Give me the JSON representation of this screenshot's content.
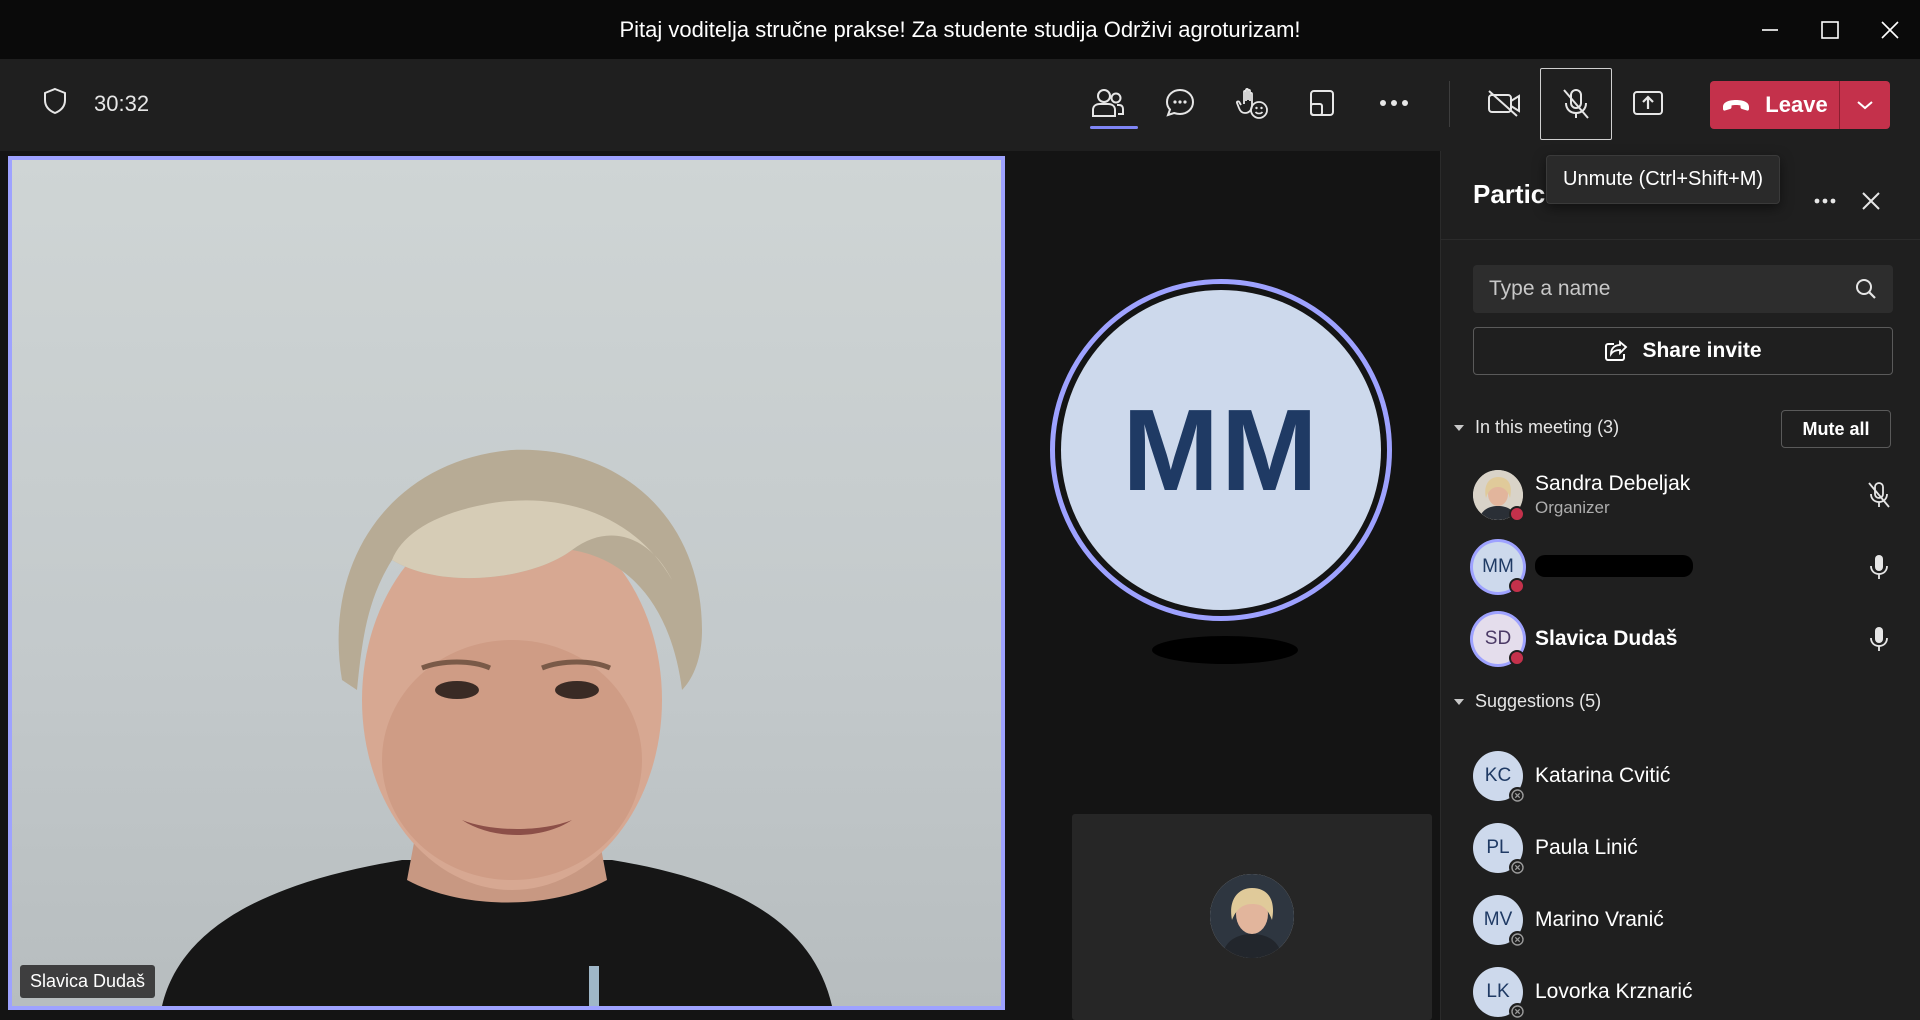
{
  "window": {
    "title": "Pitaj voditelja stručne prakse! Za studente studija Održivi agroturizam!"
  },
  "toolbar": {
    "timer": "30:32",
    "leave_label": "Leave"
  },
  "tooltip": {
    "text": "Unmute (Ctrl+Shift+M)"
  },
  "stage": {
    "main_video_name": "Slavica Dudaš",
    "big_avatar_initials": "MM"
  },
  "panel": {
    "title": "Participants",
    "title_visible": "Partici",
    "search_placeholder": "Type a name",
    "share_invite": "Share invite",
    "in_meeting_label": "In this meeting (3)",
    "mute_all": "Mute all",
    "suggestions_label": "Suggestions (5)",
    "in_meeting": [
      {
        "initials": "",
        "name": "Sandra Debeljak",
        "role": "Organizer",
        "mic": "mic-off-icon"
      },
      {
        "initials": "MM",
        "name": "",
        "role": "",
        "mic": "mic-icon"
      },
      {
        "initials": "SD",
        "name": "Slavica Dudaš",
        "role": "",
        "mic": "mic-icon"
      }
    ],
    "suggestions": [
      {
        "initials": "KC",
        "name": "Katarina Cvitić"
      },
      {
        "initials": "PL",
        "name": "Paula Linić"
      },
      {
        "initials": "MV",
        "name": "Marino Vranić"
      },
      {
        "initials": "LK",
        "name": "Lovorka Krznarić"
      }
    ]
  },
  "colors": {
    "accent": "#9ea2ff",
    "leave": "#c4314b",
    "avatar_bg": "#cdd9ec",
    "avatar_text": "#1f3a64"
  }
}
